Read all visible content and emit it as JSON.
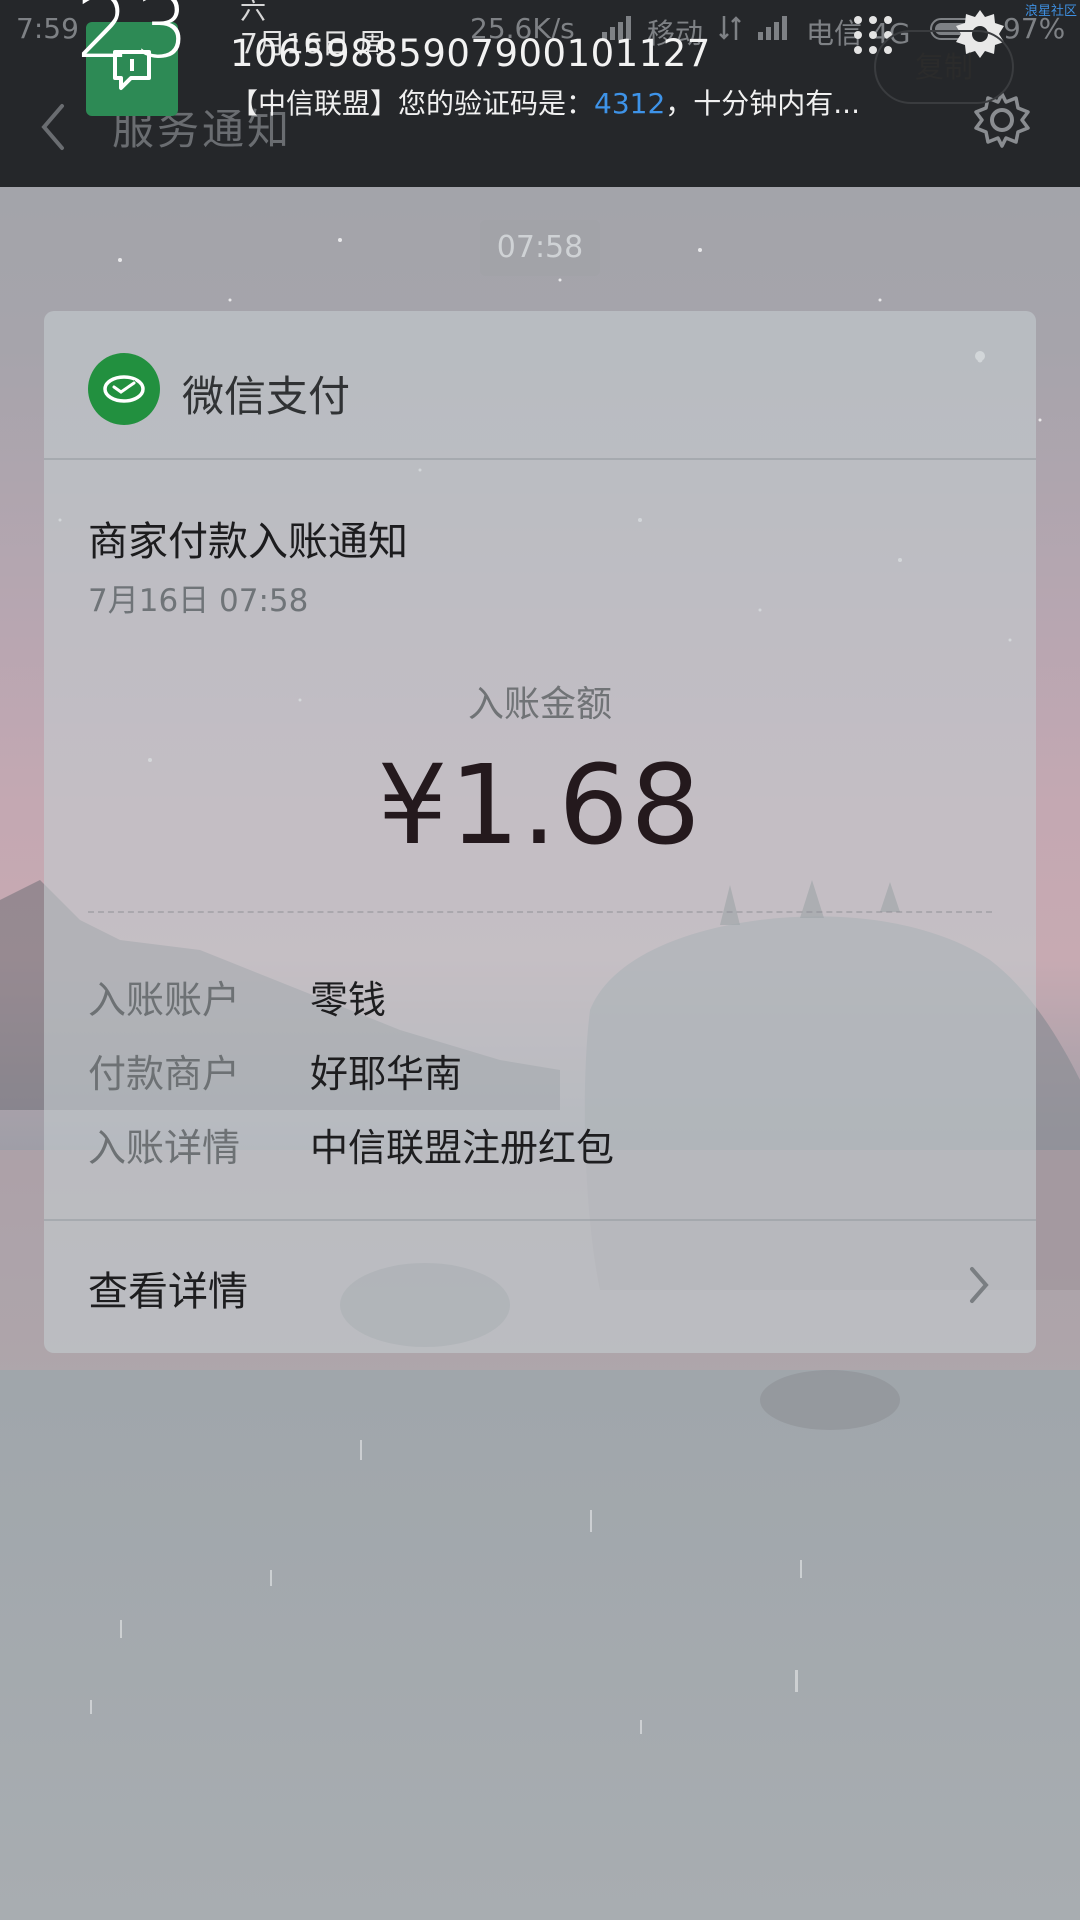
{
  "status_bar": {
    "time": "7:59",
    "net_speed": "25.6K/s",
    "carrier_1": "移动",
    "carrier_2": "电信 4G",
    "battery_pct": "97%",
    "watermark": "浪星社区"
  },
  "header": {
    "title": "服务通知",
    "back_icon": "chevron-left-icon",
    "settings_icon": "gear-icon"
  },
  "notification": {
    "big_number": "23",
    "weekday_fragment": "六",
    "date": "7月16日 周",
    "sender": "1065988590790010112​7",
    "message_prefix": "【中信联盟】您的验证码是：",
    "code": "4312",
    "message_suffix": "，十分钟内有...",
    "copy_label": "复制",
    "accent_color": "#3e93e8"
  },
  "chat": {
    "timestamp": "07:58"
  },
  "card": {
    "brand": "微信支付",
    "brand_color": "#22903f",
    "title": "商家付款入账通知",
    "datetime": "7月16日  07:58",
    "amount_label": "入账金额",
    "amount": "¥1.68",
    "rows": [
      {
        "label": "入账账户",
        "value": "零钱"
      },
      {
        "label": "付款商户",
        "value": "好耶华南"
      },
      {
        "label": "入账详情",
        "value": "中信联盟注册红包"
      }
    ],
    "detail_link": "查看详情"
  }
}
